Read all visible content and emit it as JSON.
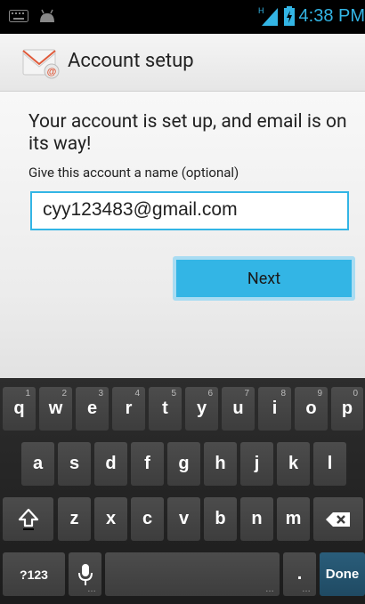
{
  "status_bar": {
    "time": "4:38 PM",
    "icons": [
      "keyboard-icon",
      "android-icon",
      "signal-icon",
      "battery-charging-icon"
    ]
  },
  "action_bar": {
    "title": "Account setup",
    "icon": "email-app-icon"
  },
  "main": {
    "headline": "Your account is set up, and email is on its way!",
    "subtitle": "Give this account a name (optional)",
    "account_name_value": "cyy123483@gmail.com",
    "next_label": "Next"
  },
  "keyboard": {
    "row1": [
      {
        "label": "q",
        "hint": "1"
      },
      {
        "label": "w",
        "hint": "2"
      },
      {
        "label": "e",
        "hint": "3"
      },
      {
        "label": "r",
        "hint": "4"
      },
      {
        "label": "t",
        "hint": "5"
      },
      {
        "label": "y",
        "hint": "6"
      },
      {
        "label": "u",
        "hint": "7"
      },
      {
        "label": "i",
        "hint": "8"
      },
      {
        "label": "o",
        "hint": "9"
      },
      {
        "label": "p",
        "hint": "0"
      }
    ],
    "row2": [
      "a",
      "s",
      "d",
      "f",
      "g",
      "h",
      "j",
      "k",
      "l"
    ],
    "row3": [
      "z",
      "x",
      "c",
      "v",
      "b",
      "n",
      "m"
    ],
    "symbols_label": "?123",
    "period_label": ".",
    "done_label": "Done"
  },
  "colors": {
    "accent": "#33b5e5",
    "keyboard_bg": "#222222"
  }
}
